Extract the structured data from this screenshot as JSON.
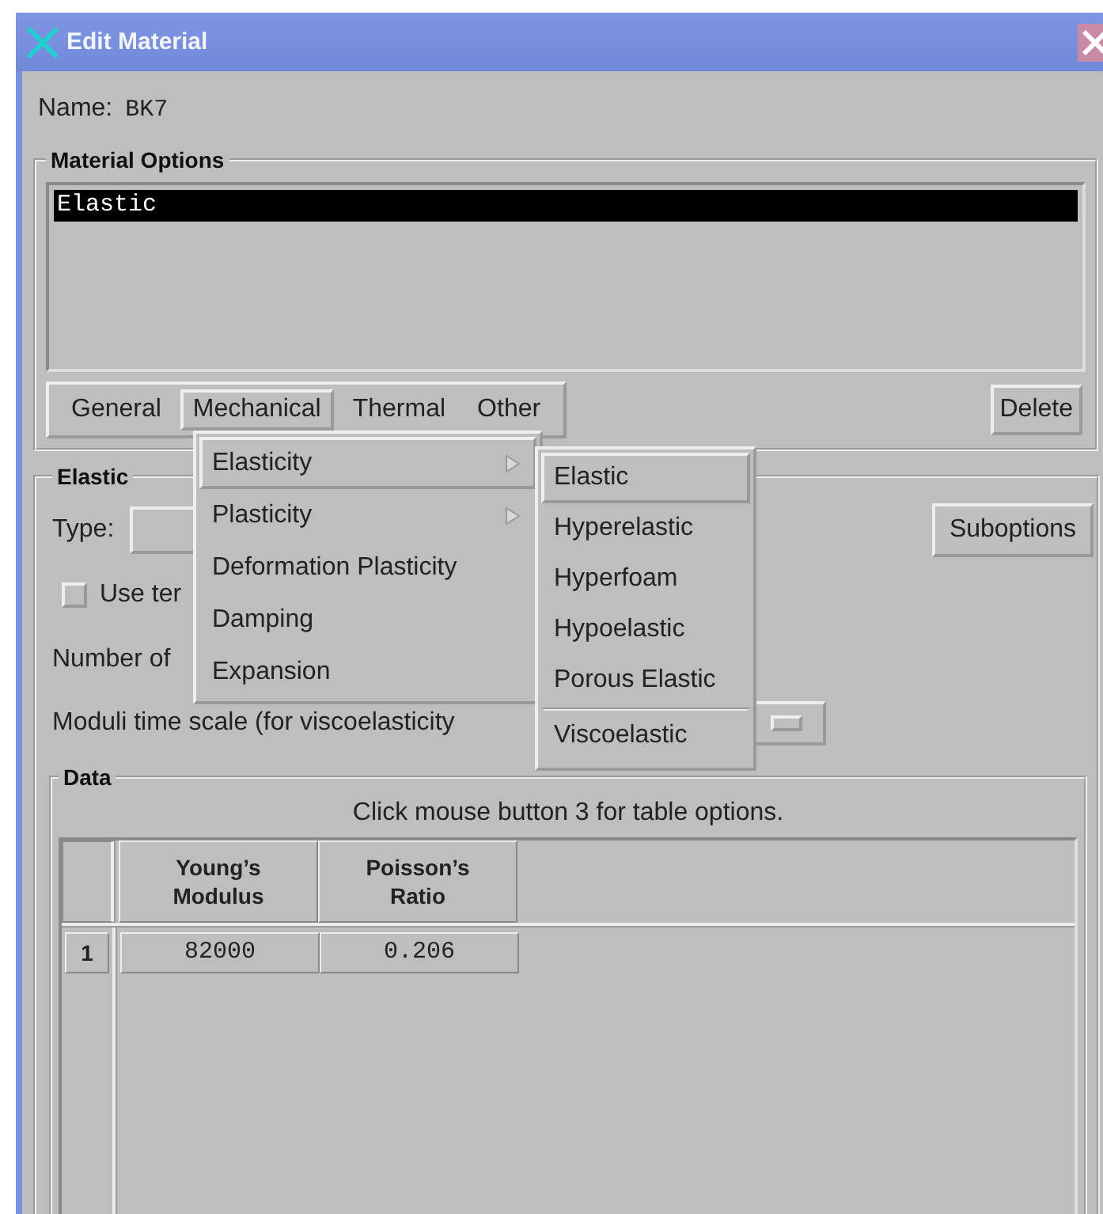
{
  "window": {
    "title": "Edit Material"
  },
  "name": {
    "label": "Name:",
    "value": "BK7"
  },
  "material_options": {
    "title": "Material Options",
    "items": [
      {
        "label": "Elastic",
        "selected": true
      }
    ],
    "menus": [
      {
        "label": "General",
        "selected": false
      },
      {
        "label": "Mechanical",
        "selected": true
      },
      {
        "label": "Thermal",
        "selected": false
      },
      {
        "label": "Other",
        "selected": false
      }
    ],
    "delete_button": "Delete"
  },
  "elastic": {
    "title": "Elastic",
    "type_label": "Type:",
    "use_temperature_label": "Use ter",
    "use_temperature_checked": false,
    "number_label": "Number of",
    "moduli_label": "Moduli time scale (for viscoelasticity",
    "suboptions_button": "Suboptions"
  },
  "mechanical_menu": [
    {
      "label": "Elasticity",
      "submenu": true,
      "selected": true
    },
    {
      "label": "Plasticity",
      "submenu": true,
      "selected": false
    },
    {
      "label": "Deformation Plasticity",
      "submenu": false,
      "selected": false
    },
    {
      "label": "Damping",
      "submenu": false,
      "selected": false
    },
    {
      "label": "Expansion",
      "submenu": false,
      "selected": false
    }
  ],
  "elasticity_submenu": [
    {
      "label": "Elastic",
      "selected": true,
      "separator_before": false
    },
    {
      "label": "Hyperelastic",
      "selected": false,
      "separator_before": false
    },
    {
      "label": "Hyperfoam",
      "selected": false,
      "separator_before": false
    },
    {
      "label": "Hypoelastic",
      "selected": false,
      "separator_before": false
    },
    {
      "label": "Porous Elastic",
      "selected": false,
      "separator_before": false
    },
    {
      "label": "Viscoelastic",
      "selected": false,
      "separator_before": true
    }
  ],
  "data": {
    "title": "Data",
    "hint": "Click mouse button 3 for table options.",
    "columns": [
      {
        "lines": [
          "Young’s",
          "Modulus"
        ]
      },
      {
        "lines": [
          "Poisson’s",
          "Ratio"
        ]
      }
    ],
    "rows": [
      {
        "index": "1",
        "cells": [
          "82000",
          "0.206"
        ]
      }
    ]
  }
}
